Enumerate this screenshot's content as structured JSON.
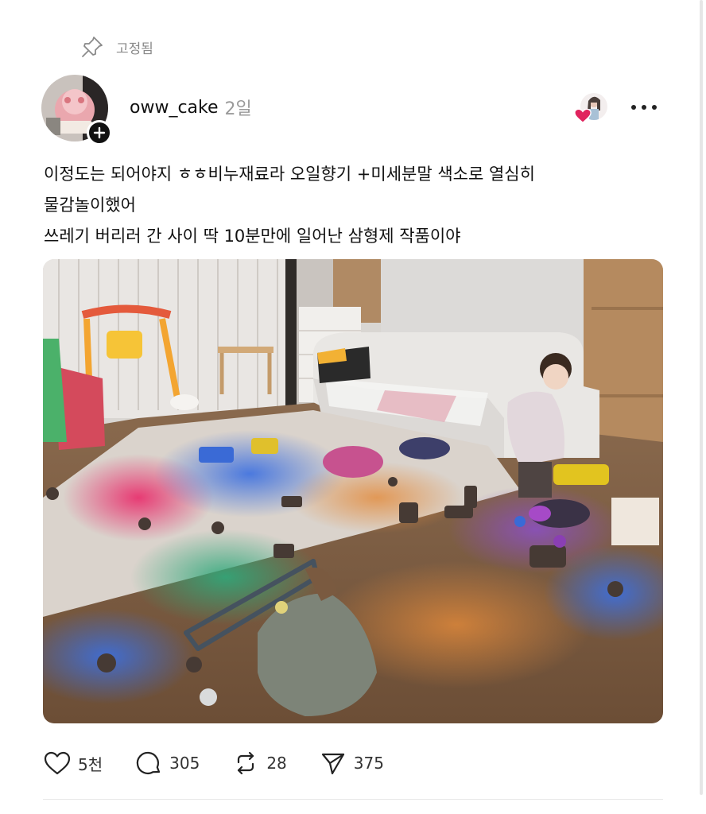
{
  "pinned": {
    "label": "고정됨",
    "icon": "pin-icon"
  },
  "post": {
    "author": {
      "username": "oww_cake",
      "avatar_icon": "profile-avatar",
      "follow_icon": "plus-icon"
    },
    "timestamp": "2일",
    "liked_by_icon": "heart-icon",
    "more_icon": "more-icon",
    "text_lines": [
      "이정도는 되어야지 ㅎㅎ비누재료라 오일향기 +미세분말 색소로 열심히",
      "물감놀이했어",
      "쓰레기 버리러 간 사이 딱 10분만에 일어난 삼형제 작품이야"
    ],
    "photo_icon": "living-room-photo",
    "stats": {
      "likes": "5천",
      "comments": "305",
      "reposts": "28",
      "shares": "375"
    }
  },
  "colors": {
    "text": "#111111",
    "muted": "#9a9a9a",
    "heart": "#e0245e"
  }
}
